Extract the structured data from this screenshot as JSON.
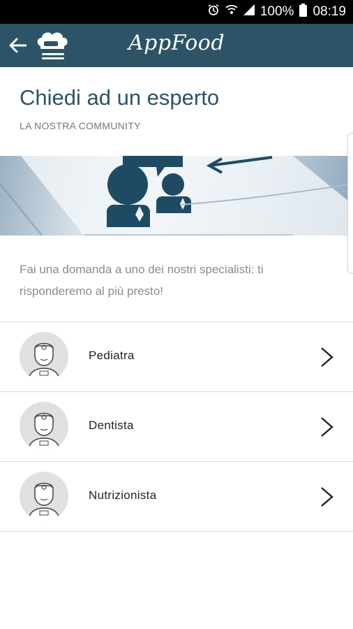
{
  "status_bar": {
    "battery": "100%",
    "time": "08:19",
    "icons": [
      "alarm-icon",
      "wifi-icon",
      "signal-icon",
      "battery-icon"
    ]
  },
  "app_bar": {
    "brand": "AppFood",
    "back_icon": "arrow-left-icon",
    "logo_icon": "chef-hat-icon"
  },
  "header": {
    "title": "Chiedi ad un esperto",
    "subtitle": "LA NOSTRA COMMUNITY"
  },
  "description": "Fai una domanda a uno dei nostri specialisti: ti risponderemo al più presto!",
  "experts": [
    {
      "label": "Pediatra"
    },
    {
      "label": "Dentista"
    },
    {
      "label": "Nutrizionista"
    }
  ],
  "colors": {
    "primary": "#2d5366",
    "accent_icon": "#1f4a63"
  }
}
